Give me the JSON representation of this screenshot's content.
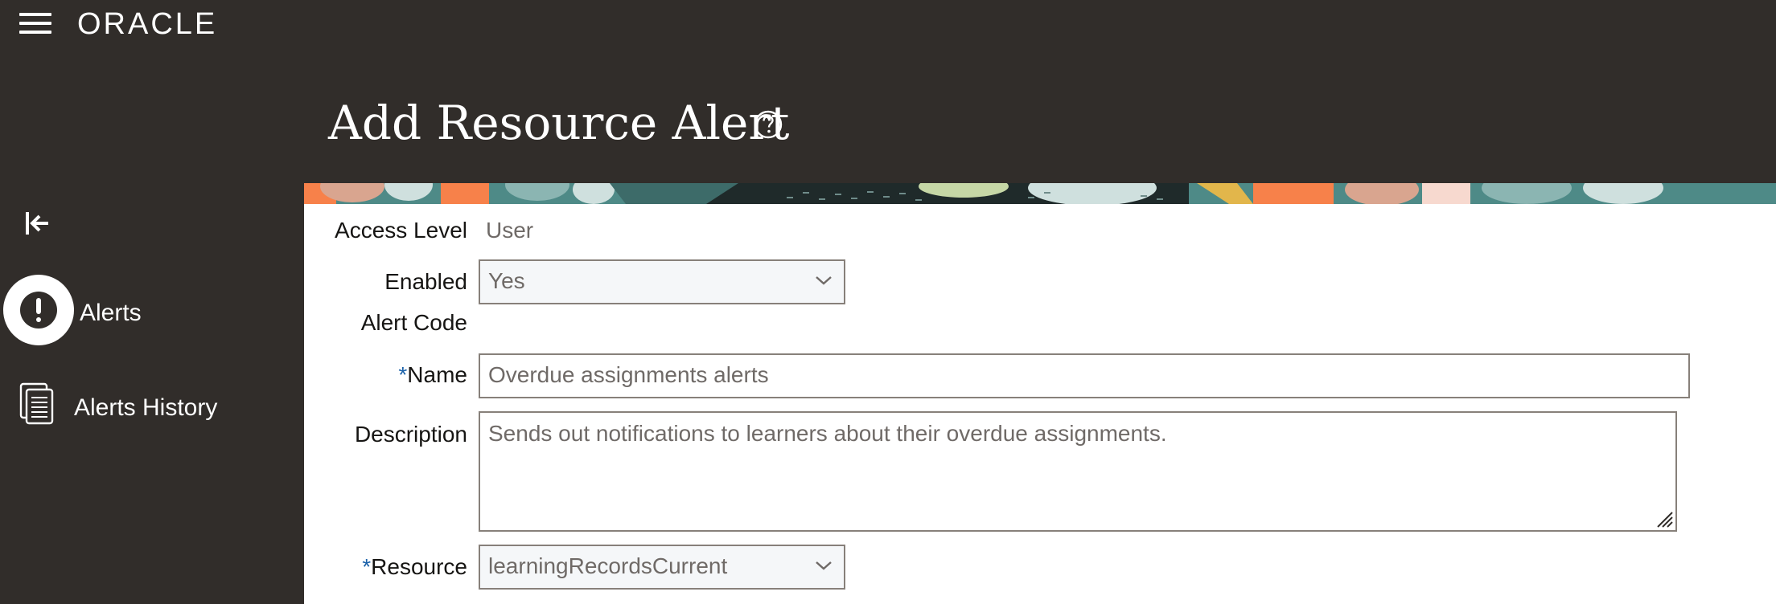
{
  "header": {
    "logo_text": "ORACLE",
    "menu_icon": "hamburger-menu-icon"
  },
  "sidebar": {
    "collapse_icon": "collapse-left-icon",
    "items": [
      {
        "label": "Alerts",
        "icon": "alert-exclamation-icon",
        "selected": true
      },
      {
        "label": "Alerts History",
        "icon": "document-list-icon",
        "selected": false
      }
    ]
  },
  "page": {
    "title": "Add Resource Alert",
    "help_icon": "help-question-icon"
  },
  "form": {
    "access_level": {
      "label": "Access Level",
      "value": "User"
    },
    "enabled": {
      "label": "Enabled",
      "value": "Yes"
    },
    "alert_code": {
      "label": "Alert Code",
      "value": ""
    },
    "name": {
      "required_mark": "*",
      "label": "Name",
      "value": "Overdue assignments alerts"
    },
    "description": {
      "label": "Description",
      "value": "Sends out notifications to learners about their overdue assignments."
    },
    "resource": {
      "required_mark": "*",
      "label": "Resource",
      "value": "learningRecordsCurrent"
    }
  },
  "colors": {
    "app_background": "#312d2a",
    "content_background": "#ffffff",
    "required_marker": "#1a61a9",
    "field_border": "#87807a",
    "banner_orange": "#f7814a",
    "banner_teal": "#4e8a87"
  }
}
